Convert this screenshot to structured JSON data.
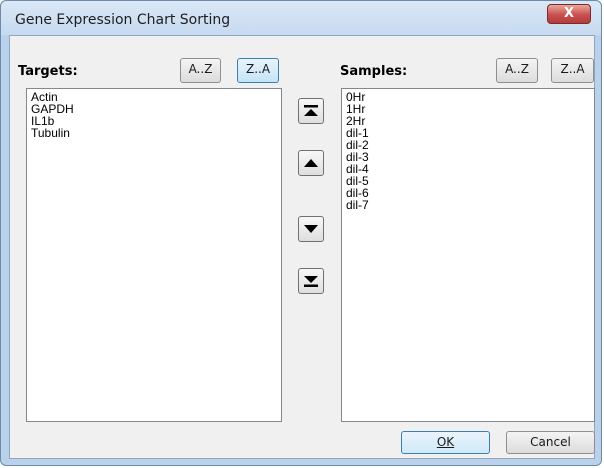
{
  "window": {
    "title": "Gene Expression Chart Sorting",
    "close_glyph": "X"
  },
  "targets": {
    "label": "Targets:",
    "sort_az": "A..Z",
    "sort_za": "Z..A",
    "items": [
      "Actin",
      "GAPDH",
      "IL1b",
      "Tubulin"
    ]
  },
  "samples": {
    "label": "Samples:",
    "sort_az": "A..Z",
    "sort_za": "Z..A",
    "items": [
      "0Hr",
      "1Hr",
      "2Hr",
      "dil-1",
      "dil-2",
      "dil-3",
      "dil-4",
      "dil-5",
      "dil-6",
      "dil-7"
    ]
  },
  "move_buttons": {
    "icons": [
      "move-to-top-icon",
      "move-up-icon",
      "move-down-icon",
      "move-to-bottom-icon"
    ]
  },
  "footer": {
    "ok_label": "OK",
    "cancel_label": "Cancel"
  }
}
